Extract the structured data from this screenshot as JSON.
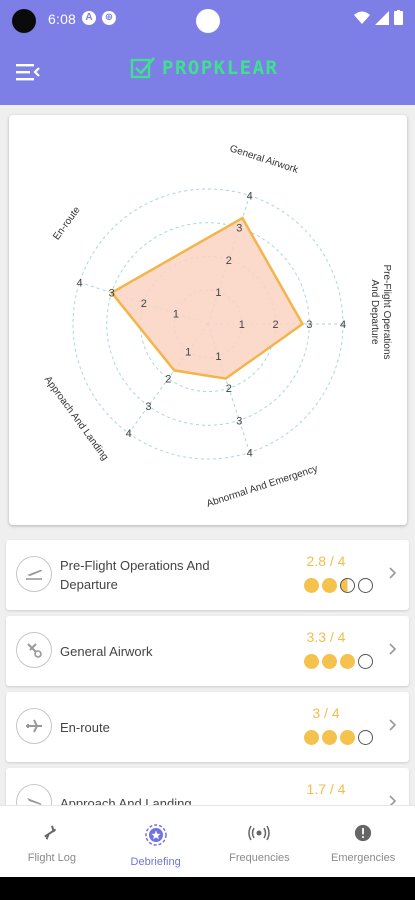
{
  "status_bar": {
    "time": "6:08"
  },
  "app": {
    "logo_text": "PROPKLEAR"
  },
  "radar": {
    "labels": {
      "general_airwork": "General Airwork",
      "preflight_line1": "Pre-Flight Operations",
      "preflight_line2": "And Departure",
      "abnormal": "Abnormal And Emergency",
      "approach": "Approach And Landing",
      "enroute": "En-route"
    },
    "ticks": [
      "1",
      "2",
      "3",
      "4"
    ],
    "values": {
      "general_airwork": 3.3,
      "preflight": 2.8,
      "abnormal": 1.7,
      "approach": 1.7,
      "enroute": 3.0
    },
    "max": 4,
    "colors": {
      "fill": "#fad4c3",
      "stroke": "#f3b44a",
      "grid": "#a9d7db"
    }
  },
  "categories": [
    {
      "label": "Pre-Flight Operations And Departure",
      "score": "2.8 / 4",
      "value": 2.8,
      "icon": "takeoff-icon"
    },
    {
      "label": "General Airwork",
      "score": "3.3 / 4",
      "value": 3.3,
      "icon": "plane-gear-icon"
    },
    {
      "label": "En-route",
      "score": "3 / 4",
      "value": 3,
      "icon": "airplane-icon"
    },
    {
      "label": "Approach And Landing",
      "score": "1.7 / 4",
      "value": 1.7,
      "icon": "landing-icon"
    }
  ],
  "nav": {
    "items": [
      {
        "label": "Flight Log",
        "icon": "airplane-icon"
      },
      {
        "label": "Debriefing",
        "icon": "star-badge-icon"
      },
      {
        "label": "Frequencies",
        "icon": "radio-waves-icon"
      },
      {
        "label": "Emergencies",
        "icon": "alert-icon"
      }
    ],
    "active_index": 1
  }
}
